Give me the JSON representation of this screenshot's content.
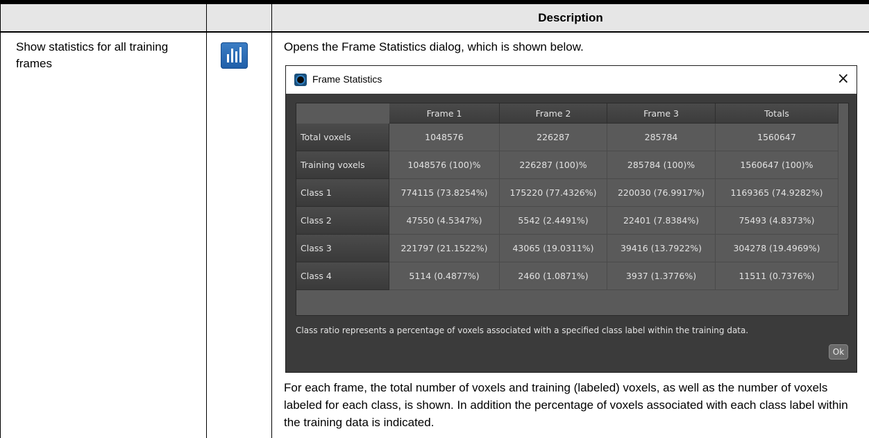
{
  "table": {
    "header": {
      "col1": "",
      "col2": "",
      "col3": "Description"
    },
    "row": {
      "label": "Show statistics for all training frames",
      "icon": "bar-chart-icon",
      "intro": "Opens the Frame Statistics dialog, which is shown below.",
      "outro": "For each frame, the total number of voxels and training (labeled) voxels, as well as the number of voxels labeled for each class, is shown. In addition the percentage of voxels associated with each class label within the training data is indicated."
    }
  },
  "dialog": {
    "title": "Frame Statistics",
    "close_glyph": "×",
    "columns": [
      "Frame 1",
      "Frame 2",
      "Frame 3",
      "Totals"
    ],
    "rows": [
      {
        "label": "Total voxels",
        "values": [
          "1048576",
          "226287",
          "285784",
          "1560647"
        ]
      },
      {
        "label": "Training voxels",
        "values": [
          "1048576 (100)%",
          "226287 (100)%",
          "285784 (100)%",
          "1560647 (100)%"
        ]
      },
      {
        "label": "Class 1",
        "values": [
          "774115 (73.8254%)",
          "175220 (77.4326%)",
          "220030 (76.9917%)",
          "1169365 (74.9282%)"
        ]
      },
      {
        "label": "Class 2",
        "values": [
          "47550 (4.5347%)",
          "5542 (2.4491%)",
          "22401 (7.8384%)",
          "75493 (4.8373%)"
        ]
      },
      {
        "label": "Class 3",
        "values": [
          "221797 (21.1522%)",
          "43065 (19.0311%)",
          "39416 (13.7922%)",
          "304278 (19.4969%)"
        ]
      },
      {
        "label": "Class 4",
        "values": [
          "5114 (0.4877%)",
          "2460 (1.0871%)",
          "3937 (1.3776%)",
          "11511 (0.7376%)"
        ]
      }
    ],
    "note": "Class ratio represents a percentage of voxels associated with a specified class label within the training data.",
    "ok_label": "Ok"
  }
}
